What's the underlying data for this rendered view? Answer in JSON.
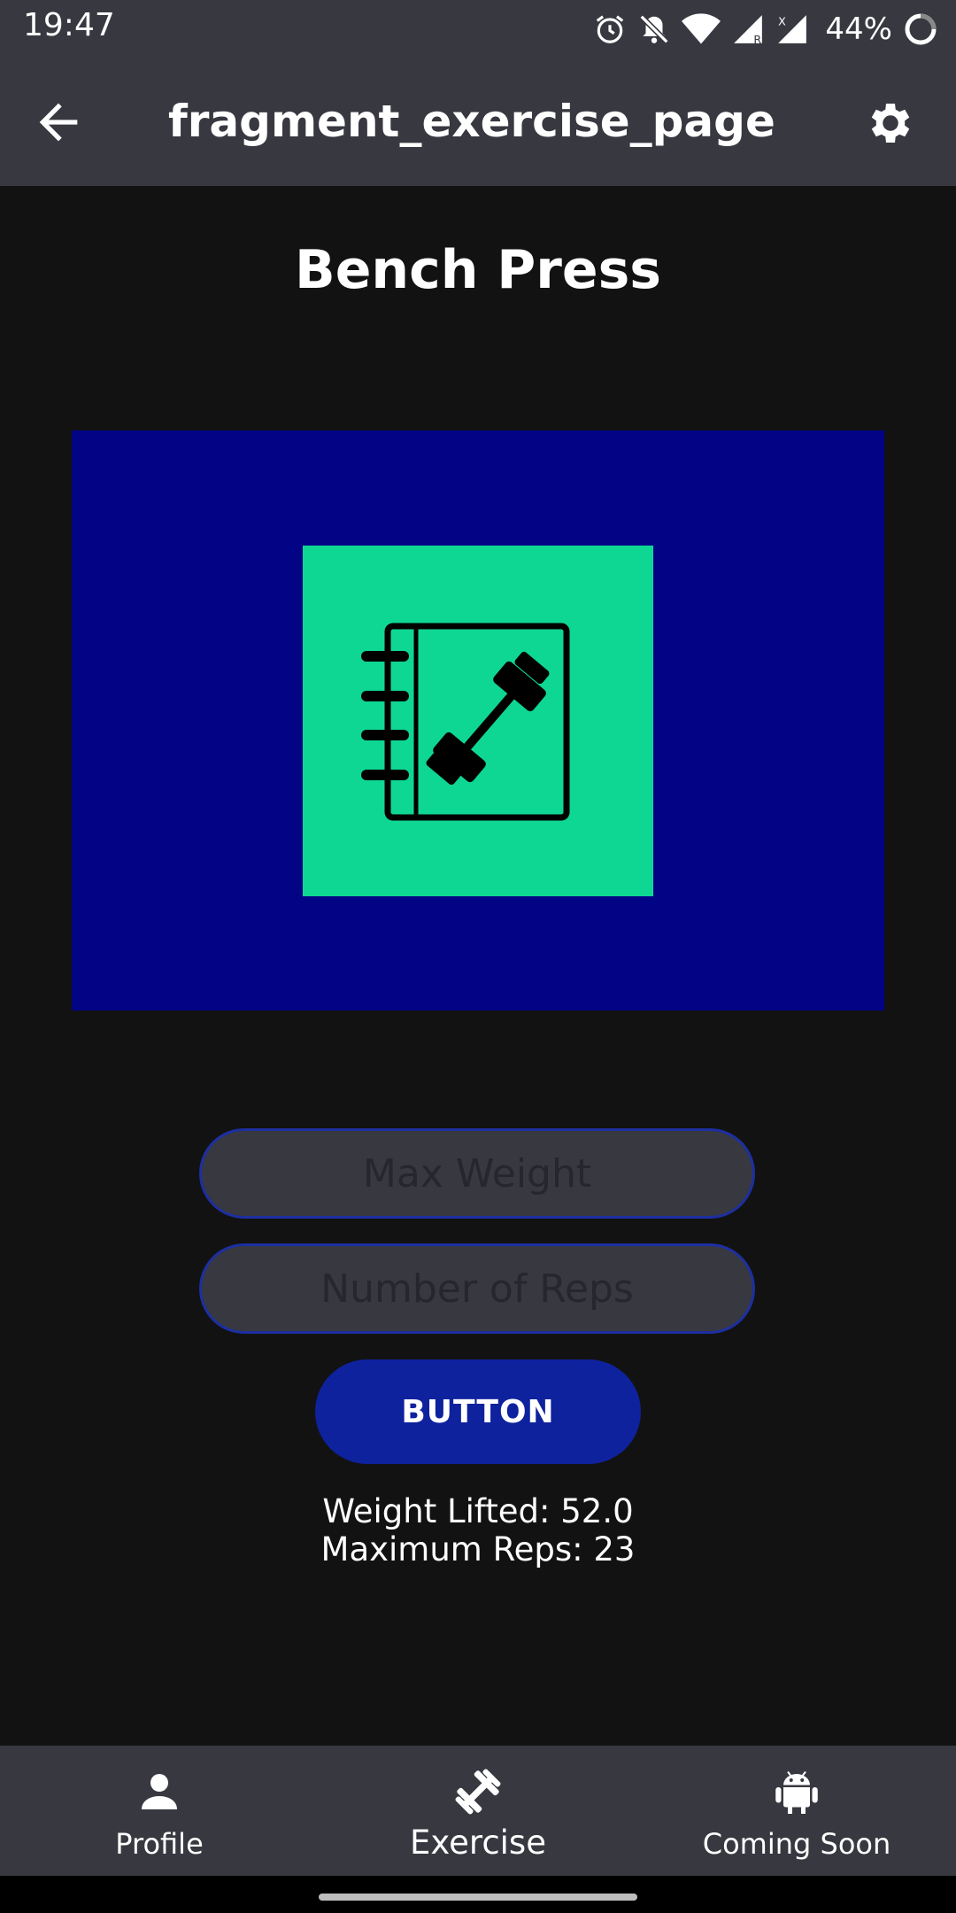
{
  "status_bar": {
    "time": "19:47",
    "battery": "44%",
    "icons": [
      "alarm-icon",
      "bell-off-icon",
      "wifi-icon",
      "signal-roaming-icon",
      "signal-no-data-icon",
      "battery-icon"
    ]
  },
  "toolbar": {
    "title": "fragment_exercise_page",
    "back_icon": "arrow-back-icon",
    "settings_icon": "gear-icon"
  },
  "main": {
    "title": "Bench Press",
    "image_icon": "workout-notebook-dumbbell-icon",
    "max_weight_placeholder": "Max Weight",
    "reps_placeholder": "Number of Reps",
    "button_label": "BUTTON",
    "weight_lifted": "Weight Lifted: 52.0",
    "maximum_reps": "Maximum Reps: 23"
  },
  "bottom_nav": {
    "items": [
      {
        "label": "Profile",
        "icon": "person-icon"
      },
      {
        "label": "Exercise",
        "icon": "dumbbell-icon",
        "active": true
      },
      {
        "label": "Coming Soon",
        "icon": "android-icon"
      }
    ]
  },
  "colors": {
    "toolbar_bg": "#383841",
    "page_bg": "#121212",
    "image_frame": "#020485",
    "image_tile": "#0ed794",
    "button_bg": "#0e229e",
    "input_border": "#1d2fa0"
  }
}
